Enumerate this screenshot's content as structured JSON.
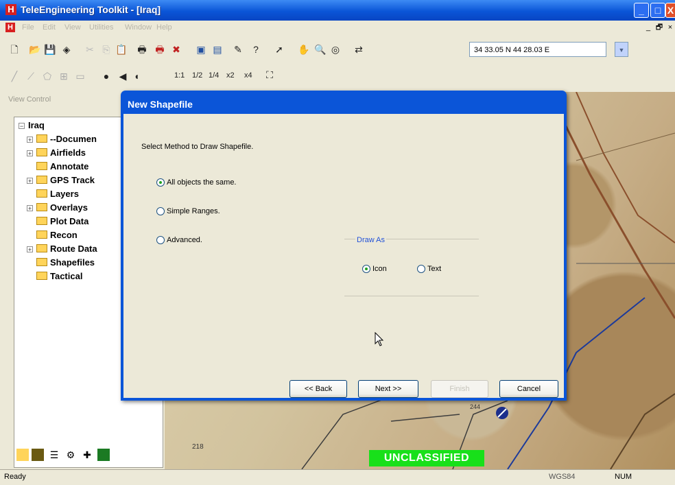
{
  "window": {
    "title": "TeleEngineering Toolkit - [Iraq]",
    "app_icon": "H",
    "controls": {
      "minimize": "_",
      "maximize": "□",
      "close": "X"
    }
  },
  "menubar": {
    "app_icon": "H",
    "items": [
      "File",
      "Edit",
      "View",
      "Utilities",
      "Window",
      "Help"
    ],
    "mdi_controls": {
      "minimize": "_",
      "restore": "🗗",
      "close": "×"
    }
  },
  "toolbar": {
    "coordinate": "34 33.05 N  44 28.03 E",
    "zoom_labels": [
      "1:1",
      "1/2",
      "1/4",
      "x2",
      "x4"
    ]
  },
  "left_panel": {
    "header": "View Control",
    "tree": {
      "root": "Iraq",
      "items": [
        {
          "label": "--Documen",
          "expandable": true
        },
        {
          "label": "Airfields",
          "expandable": true
        },
        {
          "label": "Annotate",
          "expandable": false
        },
        {
          "label": "GPS Track",
          "expandable": true
        },
        {
          "label": "Layers",
          "expandable": false
        },
        {
          "label": "Overlays",
          "expandable": true
        },
        {
          "label": "Plot Data",
          "expandable": false
        },
        {
          "label": "Recon",
          "expandable": false
        },
        {
          "label": "Route Data",
          "expandable": true
        },
        {
          "label": "Shapefiles",
          "expandable": false
        },
        {
          "label": "Tactical",
          "expandable": false
        }
      ]
    }
  },
  "map": {
    "banner": "UNCLASSIFIED",
    "banner_color": "#18e01a",
    "labels": [
      "218",
      "244"
    ]
  },
  "dialog": {
    "title": "New Shapefile",
    "prompt": "Select Method to Draw Shapefile.",
    "methods": [
      {
        "label": "All objects the same.",
        "checked": true
      },
      {
        "label": "Simple Ranges.",
        "checked": false
      },
      {
        "label": "Advanced.",
        "checked": false
      }
    ],
    "draw_as": {
      "label": "Draw As",
      "options": [
        {
          "label": "Icon",
          "checked": true
        },
        {
          "label": "Text",
          "checked": false
        }
      ]
    },
    "buttons": {
      "back": "<< Back",
      "next": "Next >>",
      "finish": "Finish",
      "cancel": "Cancel"
    }
  },
  "status": {
    "left": "Ready",
    "datum": "WGS84",
    "num": "NUM"
  }
}
